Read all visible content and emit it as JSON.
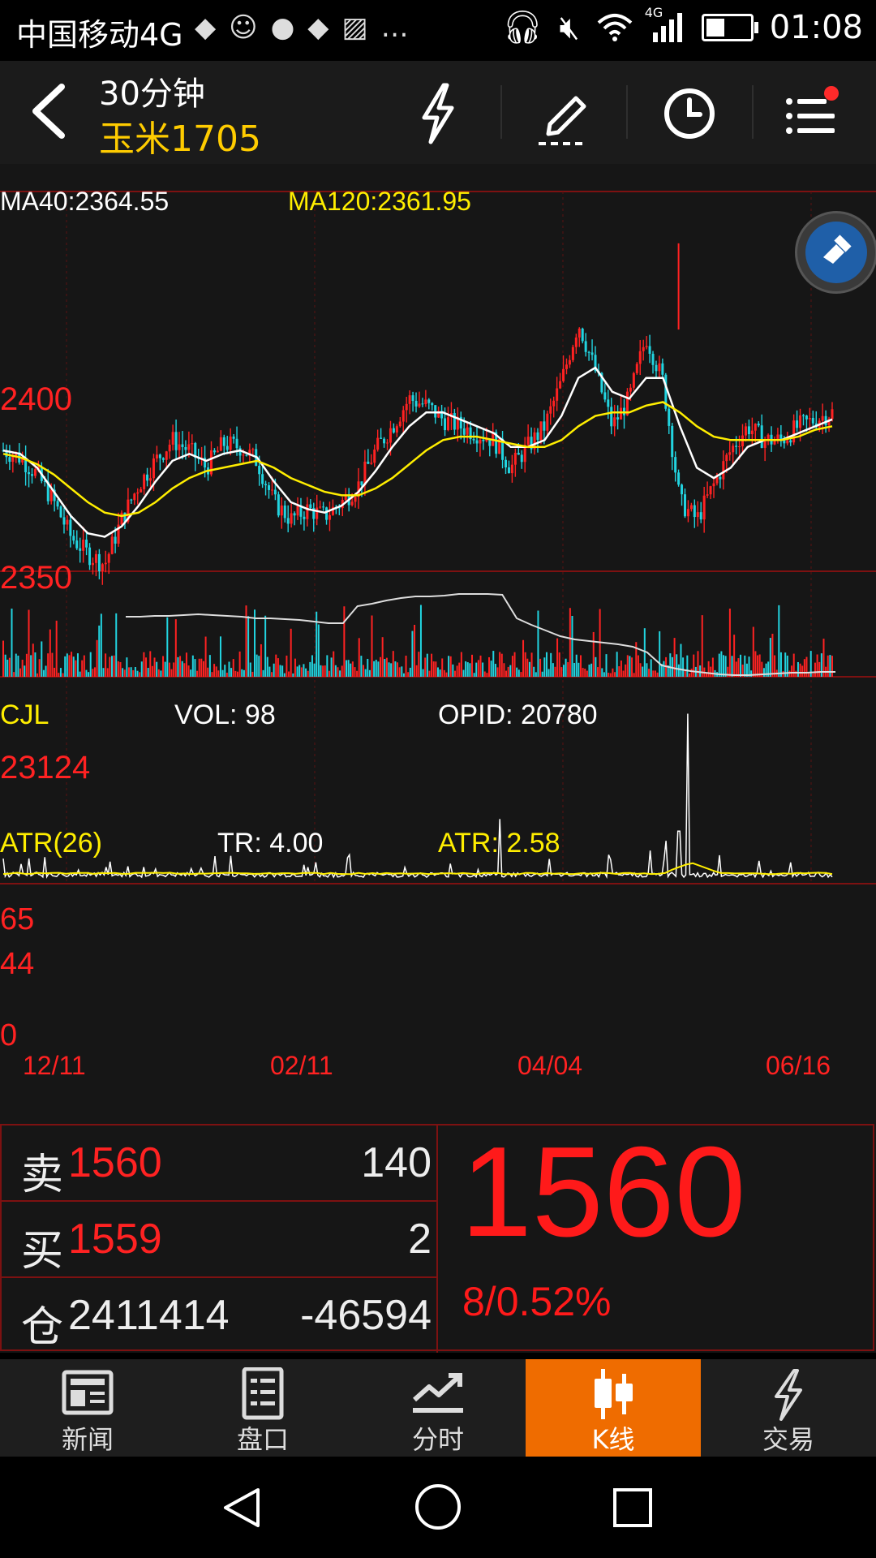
{
  "status_bar": {
    "carrier": "中国移动4G",
    "network": "4G",
    "time": "01:08",
    "icons": [
      "image-notification-icon",
      "avatar-notification-icon",
      "app-notification-icon",
      "image-notification-icon",
      "gallery-icon",
      "more-notifications-icon",
      "headset-icon",
      "mute-icon",
      "wifi-icon",
      "signal-icon",
      "battery-icon"
    ]
  },
  "header": {
    "period": "30分钟",
    "symbol": "玉米1705",
    "buttons": [
      "flash-icon",
      "draw-pen-icon",
      "clock-icon",
      "menu-icon"
    ]
  },
  "chart": {
    "ma40_label": "MA40:2364.55",
    "ma120_label": "MA120:2361.95",
    "price_ticks": [
      "2400",
      "2350"
    ],
    "vol_title": "CJL",
    "vol_label": "VOL: 98",
    "opid_label": "OPID: 20780",
    "vol_tick": "23124",
    "atr_title": "ATR(26)",
    "tr_label": "TR: 4.00",
    "atr_label": "ATR: 2.58",
    "atr_ticks": [
      "65",
      "44",
      "0"
    ],
    "dates": [
      "12/11",
      "02/11",
      "04/04",
      "06/16"
    ],
    "colors": {
      "up": "#ff2222",
      "down": "#22d4e0",
      "ma40": "#ffffff",
      "ma120": "#ffee00",
      "axis": "#ff2222"
    }
  },
  "chart_data": {
    "type": "candlestick",
    "title": "",
    "x": [
      "12/11",
      "02/11",
      "04/04",
      "06/16"
    ],
    "price_ylim": [
      2320,
      2430
    ],
    "ma40_last": 2364.55,
    "ma120_last": 2361.95,
    "price_path": [
      2355,
      2353,
      2348,
      2340,
      2330,
      2325,
      2322,
      2335,
      2345,
      2352,
      2358,
      2355,
      2350,
      2357,
      2356,
      2352,
      2340,
      2335,
      2338,
      2336,
      2340,
      2345,
      2355,
      2362,
      2370,
      2368,
      2364,
      2362,
      2360,
      2358,
      2350,
      2356,
      2362,
      2375,
      2392,
      2378,
      2362,
      2370,
      2388,
      2375,
      2340,
      2335,
      2345,
      2355,
      2362,
      2358,
      2358,
      2362,
      2364,
      2366
    ],
    "ma_fast": [
      2355,
      2354,
      2350,
      2343,
      2336,
      2331,
      2330,
      2333,
      2339,
      2346,
      2352,
      2354,
      2352,
      2354,
      2355,
      2353,
      2346,
      2340,
      2338,
      2337,
      2339,
      2343,
      2349,
      2356,
      2362,
      2366,
      2366,
      2364,
      2362,
      2360,
      2356,
      2356,
      2358,
      2365,
      2376,
      2379,
      2372,
      2370,
      2376,
      2376,
      2362,
      2350,
      2347,
      2350,
      2356,
      2358,
      2358,
      2360,
      2362,
      2364
    ],
    "ma_slow": [
      2354,
      2353,
      2351,
      2348,
      2344,
      2340,
      2337,
      2336,
      2337,
      2340,
      2344,
      2347,
      2349,
      2350,
      2351,
      2352,
      2350,
      2347,
      2345,
      2343,
      2342,
      2342,
      2344,
      2347,
      2351,
      2355,
      2358,
      2359,
      2359,
      2358,
      2357,
      2356,
      2356,
      2358,
      2362,
      2365,
      2366,
      2366,
      2368,
      2369,
      2366,
      2362,
      2359,
      2358,
      2358,
      2358,
      2358,
      2359,
      2361,
      2362
    ],
    "volume_tick": 23124,
    "vol_last": 98,
    "opid_last": 20780,
    "opid_path": [
      0.72,
      0.72,
      0.73,
      0.73,
      0.74,
      0.75,
      0.74,
      0.73,
      0.72,
      0.7,
      0.7,
      0.69,
      0.68,
      0.66,
      0.64,
      0.64,
      0.85,
      0.88,
      0.92,
      0.95,
      0.97,
      0.97,
      0.98,
      1.0,
      1.0,
      1.0,
      0.99,
      0.7,
      0.62,
      0.55,
      0.48,
      0.44,
      0.42,
      0.4,
      0.38,
      0.35,
      0.28,
      0.12,
      0.08,
      0.05,
      0.03,
      0.01,
      0.0,
      0.0,
      0.01,
      0.02,
      0.03,
      0.03,
      0.04,
      0.04
    ],
    "atr_ticks": [
      0,
      44,
      65
    ],
    "tr_last": 4.0,
    "atr_last": 2.58,
    "atr_spikes": [
      {
        "t": 0.6,
        "v": 48
      },
      {
        "t": 0.8,
        "v": 30
      },
      {
        "t": 0.815,
        "v": 38
      },
      {
        "t": 0.825,
        "v": 135
      },
      {
        "t": 0.78,
        "v": 22
      }
    ]
  },
  "quote": {
    "sell_label": "卖",
    "sell_price": "1560",
    "sell_qty": "140",
    "buy_label": "买",
    "buy_price": "1559",
    "buy_qty": "2",
    "oi_label": "仓",
    "oi_value": "2411414",
    "oi_change": "-46594",
    "last_price": "1560",
    "change": "8/0.52%"
  },
  "tabs": [
    {
      "label": "新闻",
      "icon": "news-icon"
    },
    {
      "label": "盘口",
      "icon": "order-book-icon"
    },
    {
      "label": "分时",
      "icon": "intraday-icon"
    },
    {
      "label": "K线",
      "icon": "candlestick-icon",
      "active": true
    },
    {
      "label": "交易",
      "icon": "trade-icon"
    }
  ]
}
